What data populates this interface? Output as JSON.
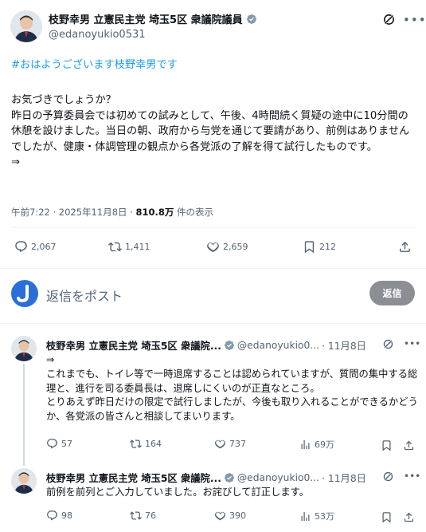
{
  "main": {
    "name": "枝野幸男 立憲民主党 埼玉5区 衆議院議員",
    "handle": "@edanoyukio0531",
    "hashtag": "#おはようございます枝野幸男です",
    "body": "お気づきでしょうか？\n昨日の予算委員会では初めての試みとして、午後、4時間続く質疑の途中に10分間の休憩を設けました。当日の朝、政府から与党を通じて要請があり、前例はありませんでしたが、健康・体調管理の観点から各党派の了解を得て試行したものです。\n⇒",
    "time": "午前7:22 · 2025年11月8日 · ",
    "views": "810.8万",
    "views_suffix": " 件の表示",
    "stats": {
      "replies": "2,067",
      "reposts": "1,411",
      "likes": "2,659",
      "bookmarks": "212"
    }
  },
  "reply_box": {
    "placeholder": "返信をポスト",
    "button": "返信"
  },
  "replies": [
    {
      "name": "枝野幸男 立憲民主党 埼玉5区 衆議院...",
      "handle": "@edanoyukio0...",
      "date": "· 11月8日",
      "text": "⇒\nこれまでも、トイレ等で一時退席することは認められていますが、質問の集中する総理と、進行を司る委員長は、退席しにくいのが正直なところ。\nとりあえず昨日だけの限定で試行しましたが、今後も取り入れることができるかどうか、各党派の皆さんと相談してまいります。",
      "stats": {
        "replies": "57",
        "reposts": "164",
        "likes": "737",
        "views": "69万"
      }
    },
    {
      "name": "枝野幸男 立憲民主党 埼玉5区 衆議院...",
      "handle": "@edanoyukio0...",
      "date": "· 11月8日",
      "text": "前例を前列とご入力していました。お詫びして訂正します。",
      "stats": {
        "replies": "98",
        "reposts": "76",
        "likes": "390",
        "views": "53万"
      }
    }
  ],
  "colors": {
    "accent": "#1d9bf0",
    "secondary_text": "#536471",
    "reply_button": "#8b8f93",
    "user_avatar": "#2b6fd6"
  }
}
